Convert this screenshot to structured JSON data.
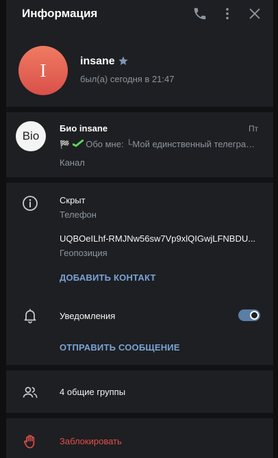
{
  "header": {
    "title": "Информация"
  },
  "profile": {
    "avatar_letter": "I",
    "name": "insane",
    "status": "был(а) сегодня в 21:47"
  },
  "channel": {
    "avatar_text": "Bio",
    "title": "Био insane",
    "time": "Пт",
    "preview_emoji": "🏁",
    "preview_text": "Обо мне: └Мой единственный телеграм-канал",
    "subtitle": "Канал"
  },
  "info": {
    "phone_value": "Скрыт",
    "phone_label": "Телефон",
    "location_value": "UQBOeILhf-RMJNw56sw7Vp9xlQIGwjLFNBDU...",
    "location_label": "Геопозиция",
    "add_contact": "ДОБАВИТЬ КОНТАКТ"
  },
  "notifications": {
    "label": "Уведомления",
    "enabled": true,
    "send_message": "ОТПРАВИТЬ СООБЩЕНИЕ"
  },
  "groups": {
    "label": "4 общие группы"
  },
  "block": {
    "label": "Заблокировать"
  },
  "colors": {
    "accent": "#7aa3d8",
    "danger": "#e64d4d",
    "avatar_gradient_top": "#f07b61",
    "avatar_gradient_bottom": "#d9504a",
    "background": "#1e1f22"
  },
  "icons": [
    "phone-icon",
    "more-icon",
    "close-icon",
    "star-icon",
    "info-icon",
    "bell-icon",
    "people-icon",
    "hand-block-icon"
  ]
}
